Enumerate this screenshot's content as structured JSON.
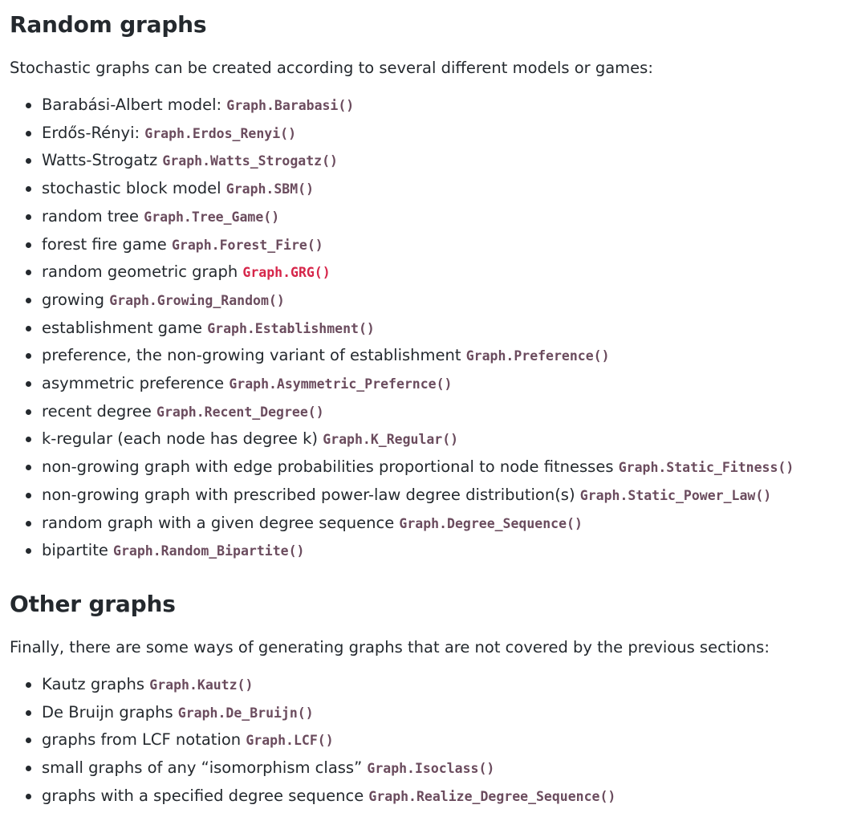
{
  "random": {
    "heading": "Random graphs",
    "intro": "Stochastic graphs can be created according to several different models or games:",
    "items": [
      {
        "text": "Barabási-Albert model: ",
        "code": "Graph.Barabasi()"
      },
      {
        "text": "Erdős-Rényi: ",
        "code": "Graph.Erdos_Renyi()"
      },
      {
        "text": "Watts-Strogatz ",
        "code": "Graph.Watts_Strogatz()"
      },
      {
        "text": "stochastic block model ",
        "code": "Graph.SBM()"
      },
      {
        "text": "random tree ",
        "code": "Graph.Tree_Game()"
      },
      {
        "text": "forest fire game ",
        "code": "Graph.Forest_Fire()"
      },
      {
        "text": "random geometric graph ",
        "code": "Graph.GRG()"
      },
      {
        "text": "growing ",
        "code": "Graph.Growing_Random()"
      },
      {
        "text": "establishment game ",
        "code": "Graph.Establishment()"
      },
      {
        "text": "preference, the non-growing variant of establishment ",
        "code": "Graph.Preference()"
      },
      {
        "text": "asymmetric preference ",
        "code": "Graph.Asymmetric_Prefernce()"
      },
      {
        "text": "recent degree ",
        "code": "Graph.Recent_Degree()"
      },
      {
        "text": "k-regular (each node has degree k) ",
        "code": "Graph.K_Regular()"
      },
      {
        "text": "non-growing graph with edge probabilities proportional to node fitnesses ",
        "code": "Graph.Static_Fitness()"
      },
      {
        "text": "non-growing graph with prescribed power-law degree distribution(s) ",
        "code": "Graph.Static_Power_Law()"
      },
      {
        "text": "random graph with a given degree sequence ",
        "code": "Graph.Degree_Sequence()"
      },
      {
        "text": "bipartite ",
        "code": "Graph.Random_Bipartite()"
      }
    ]
  },
  "other": {
    "heading": "Other graphs",
    "intro": "Finally, there are some ways of generating graphs that are not covered by the previous sections:",
    "items": [
      {
        "text": "Kautz graphs ",
        "code": "Graph.Kautz()"
      },
      {
        "text": "De Bruijn graphs ",
        "code": "Graph.De_Bruijn()"
      },
      {
        "text": "graphs from LCF notation ",
        "code": "Graph.LCF()"
      },
      {
        "text": "small graphs of any “isomorphism class” ",
        "code": "Graph.Isoclass()"
      },
      {
        "text": "graphs with a specified degree sequence ",
        "code": "Graph.Realize_Degree_Sequence()"
      }
    ]
  },
  "colors": {
    "text": "#24292e",
    "code": "#6b4c5e",
    "code_highlight": "#d6264a"
  },
  "highlighted_code": "Graph.GRG()"
}
